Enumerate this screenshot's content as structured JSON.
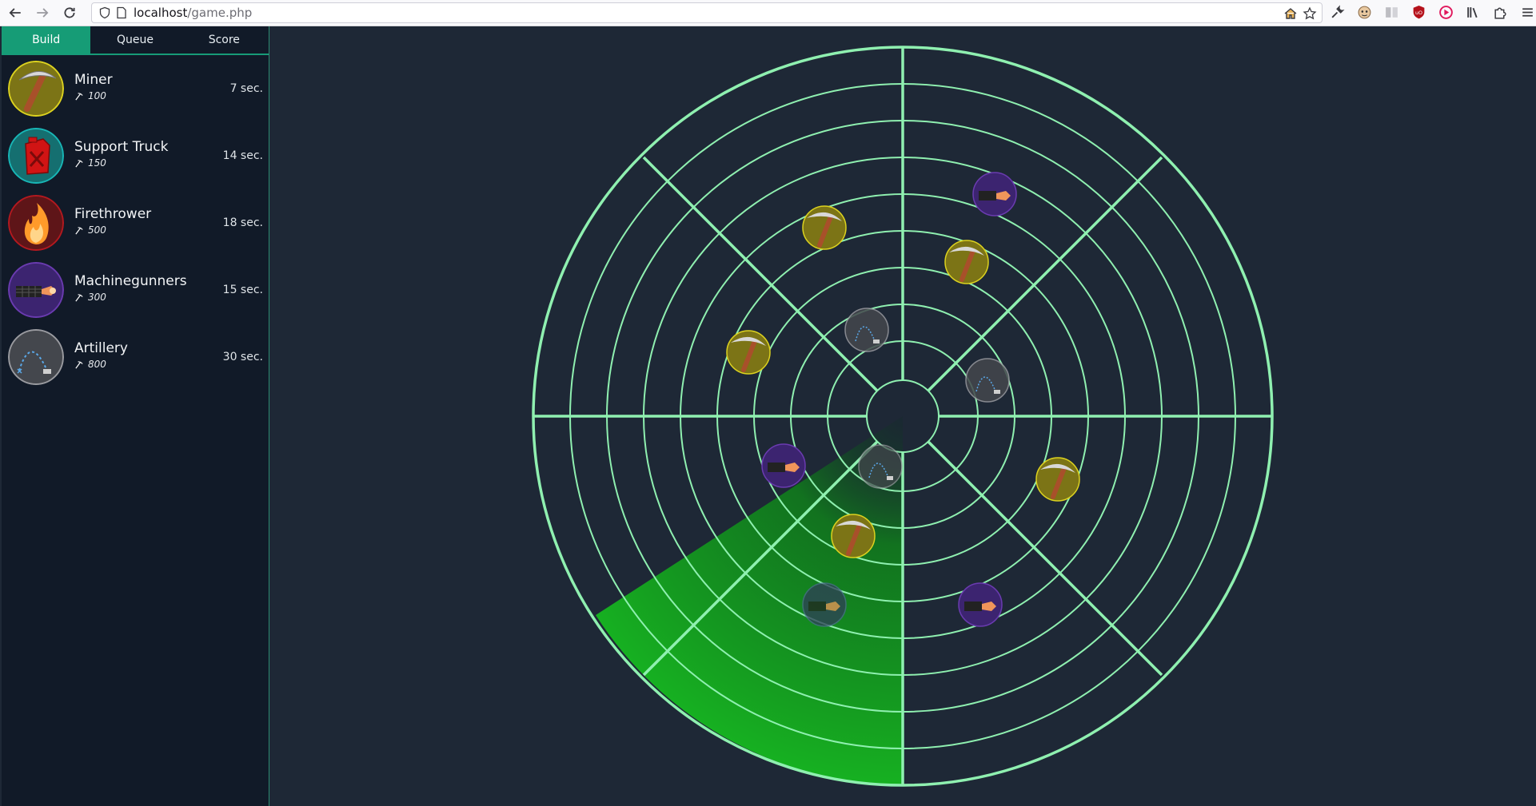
{
  "browser": {
    "url_host": "localhost",
    "url_path": "/game.php"
  },
  "tabs": [
    {
      "label": "Build",
      "active": true
    },
    {
      "label": "Queue",
      "active": false
    },
    {
      "label": "Score",
      "active": false
    }
  ],
  "units": [
    {
      "name": "Miner",
      "cost": "100",
      "time": "7 sec.",
      "icon": "pickaxe-icon",
      "color": "#c8c31d"
    },
    {
      "name": "Support Truck",
      "cost": "150",
      "time": "14 sec.",
      "icon": "fuel-can-icon",
      "color": "#16a3a8"
    },
    {
      "name": "Firethrower",
      "cost": "500",
      "time": "18 sec.",
      "icon": "flame-icon",
      "color": "#a3161b"
    },
    {
      "name": "Machinegunners",
      "cost": "300",
      "time": "15 sec.",
      "icon": "machinegun-icon",
      "color": "#5b2f9a"
    },
    {
      "name": "Artillery",
      "cost": "800",
      "time": "30 sec.",
      "icon": "artillery-icon",
      "color": "#8e8f95"
    }
  ],
  "colors": {
    "radar_line": "#8ff0b0",
    "sweep": "#12a81e",
    "background": "#1e2836"
  }
}
